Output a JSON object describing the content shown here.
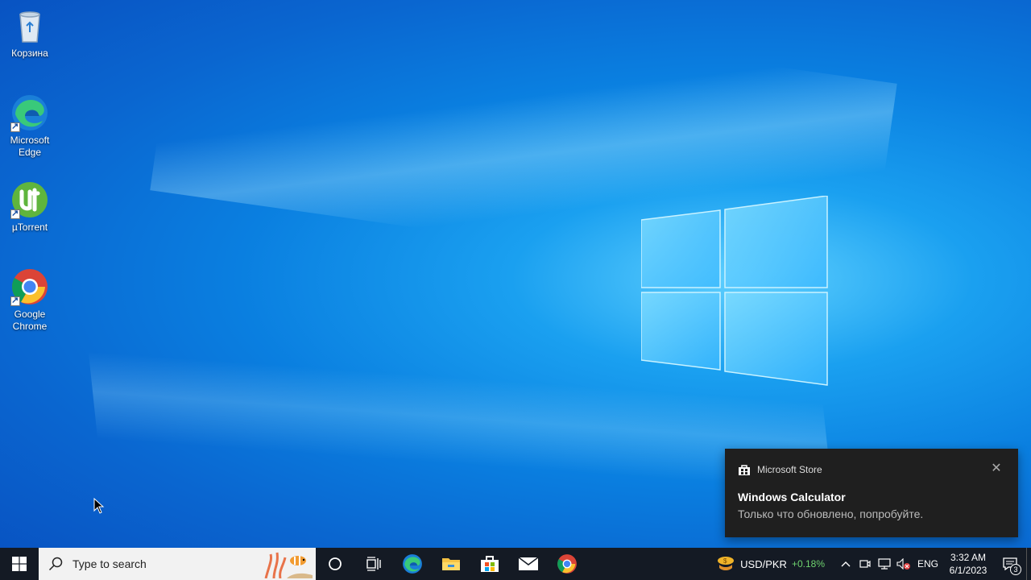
{
  "desktop": {
    "icons": [
      {
        "label": "Корзина"
      },
      {
        "label": "Microsoft Edge"
      },
      {
        "label": "µTorrent"
      },
      {
        "label": "Google Chrome"
      }
    ]
  },
  "toast": {
    "app": "Microsoft Store",
    "title": "Windows Calculator",
    "body": "Только что обновлено, попробуйте."
  },
  "taskbar": {
    "search_placeholder": "Type to search",
    "pinned": [
      "cortana-icon",
      "task-view-icon",
      "edge-icon",
      "file-explorer-icon",
      "store-icon",
      "mail-icon",
      "chrome-icon"
    ],
    "widget": {
      "currency": "USD/PKR",
      "change": "+0.18%",
      "change_color": "#6fd36f"
    },
    "language": "ENG",
    "time": "3:32 AM",
    "date": "6/1/2023",
    "notification_count": "3"
  }
}
